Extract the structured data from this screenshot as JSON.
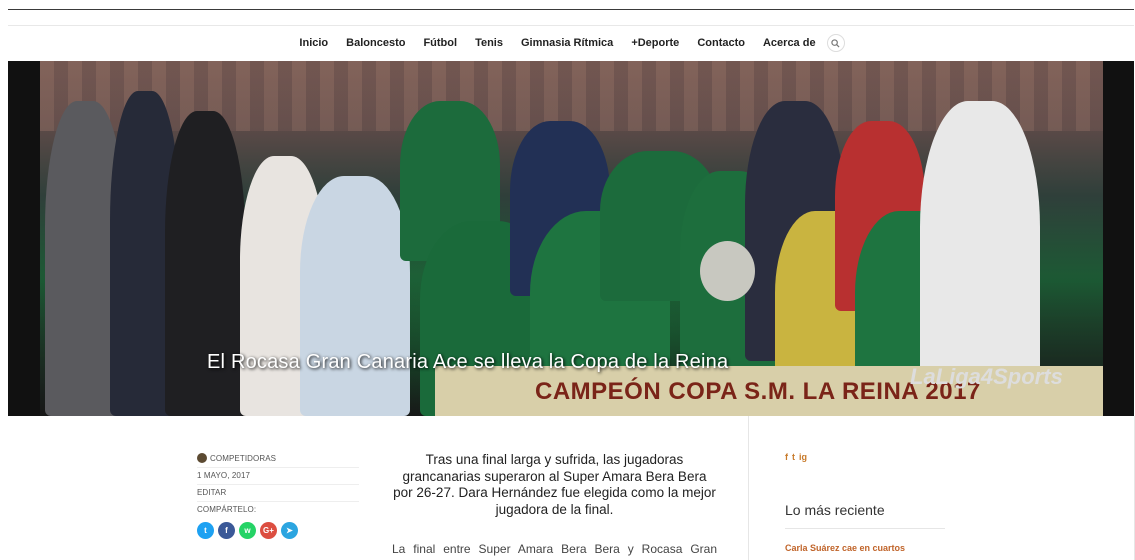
{
  "nav": {
    "items": [
      "Inicio",
      "Baloncesto",
      "Fútbol",
      "Tenis",
      "Gimnasia Rítmica",
      "+Deporte",
      "Contacto",
      "Acerca de"
    ]
  },
  "hero": {
    "title": "El Rocasa Gran Canaria Ace se lleva la Copa de la Reina",
    "banner_text": "CAMPEÓN COPA S.M. LA REINA 2017",
    "sponsor_text": "LaLiga4Sports"
  },
  "post_meta": {
    "category": "COMPETIDORAS",
    "date": "1 MAYO, 2017",
    "edit": "EDITAR",
    "share_label": "COMPÁRTELO:",
    "share_buttons": [
      "twitter",
      "facebook",
      "whatsapp",
      "google-plus",
      "telegram"
    ]
  },
  "article": {
    "lead": "Tras una final larga y sufrida, las jugadoras grancanarias superaron al Super Amara Bera Bera por 26-27. Dara Hernández fue elegida como la mejor jugadora de la final.",
    "body_first_line": "La final entre Super Amara Bera Bera y Rocasa Gran"
  },
  "sidebar": {
    "social": [
      "f",
      "t",
      "ig"
    ],
    "widget_title": "Lo más reciente",
    "recent": [
      "Carla Suárez cae en cuartos"
    ]
  },
  "colors": {
    "accent": "#c0642a",
    "share_twitter": "#1da1f2",
    "share_facebook": "#3b5998",
    "share_whatsapp": "#25d366",
    "share_google": "#dc4e41",
    "share_telegram": "#2ca5e0"
  }
}
